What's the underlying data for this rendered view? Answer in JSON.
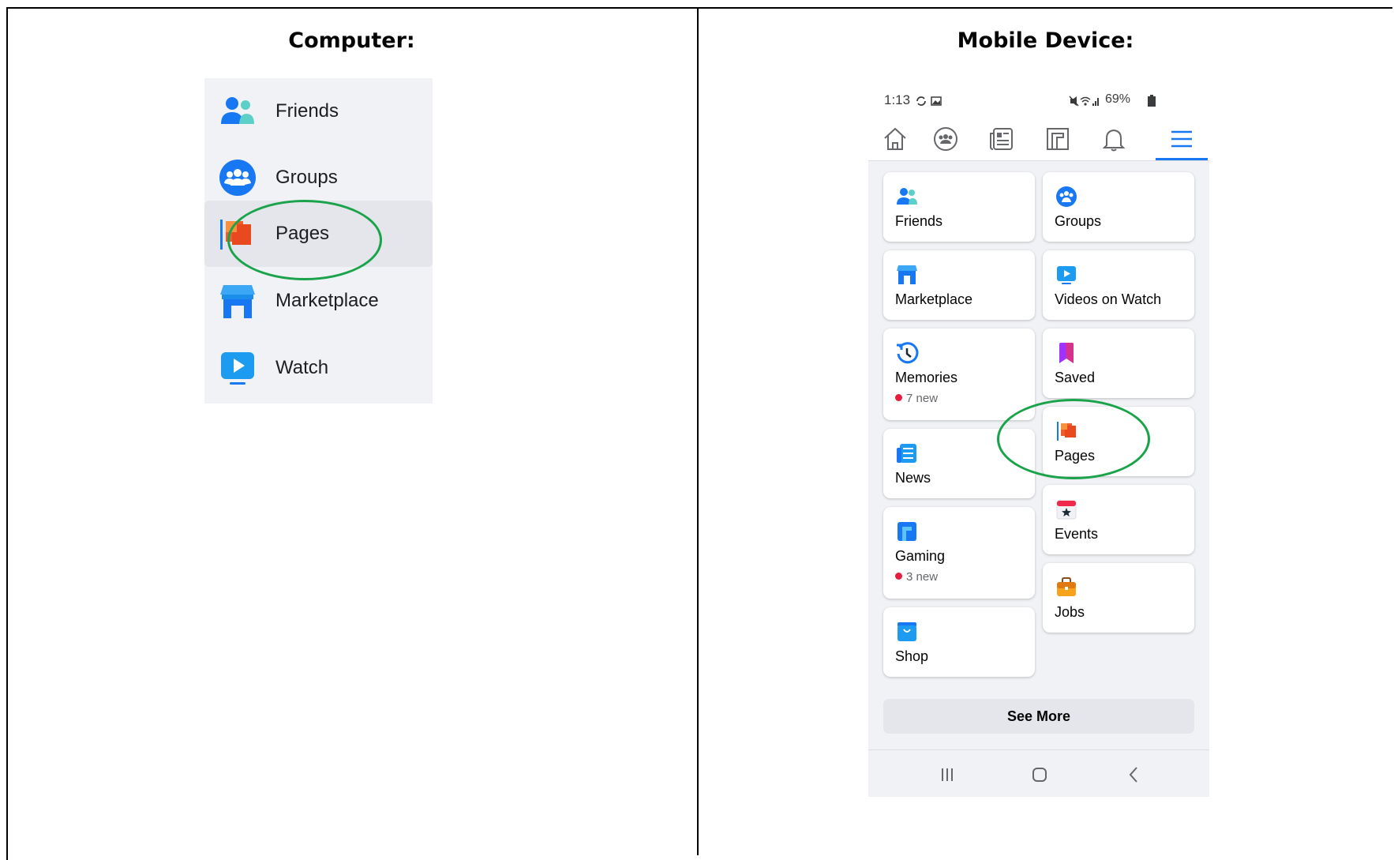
{
  "headings": {
    "computer": "Computer:",
    "mobile": "Mobile Device:"
  },
  "computer_sidebar": {
    "items": [
      {
        "label": "Friends",
        "icon": "friends-icon"
      },
      {
        "label": "Groups",
        "icon": "groups-icon"
      },
      {
        "label": "Pages",
        "icon": "pages-icon",
        "active": true
      },
      {
        "label": "Marketplace",
        "icon": "marketplace-icon"
      },
      {
        "label": "Watch",
        "icon": "watch-icon"
      }
    ]
  },
  "mobile": {
    "status_bar": {
      "time": "1:13",
      "battery": "69%"
    },
    "nav_icons": [
      "home-icon",
      "groups-icon",
      "news-icon",
      "gaming-icon",
      "bell-icon",
      "menu-icon"
    ],
    "left_tiles": [
      {
        "label": "Friends",
        "icon": "friends-icon"
      },
      {
        "label": "Marketplace",
        "icon": "marketplace-icon"
      },
      {
        "label": "Memories",
        "icon": "memories-icon",
        "badge": "7 new"
      },
      {
        "label": "News",
        "icon": "news-icon"
      },
      {
        "label": "Gaming",
        "icon": "gaming-icon",
        "badge": "3 new"
      },
      {
        "label": "Shop",
        "icon": "shop-icon"
      }
    ],
    "right_tiles": [
      {
        "label": "Groups",
        "icon": "groups-icon"
      },
      {
        "label": "Videos on Watch",
        "icon": "watch-icon"
      },
      {
        "label": "Saved",
        "icon": "saved-icon"
      },
      {
        "label": "Pages",
        "icon": "pages-icon"
      },
      {
        "label": "Events",
        "icon": "events-icon"
      },
      {
        "label": "Jobs",
        "icon": "jobs-icon"
      }
    ],
    "see_more": "See More"
  },
  "colors": {
    "highlight_circle": "#1aa34a",
    "facebook_blue": "#1877f2",
    "badge_dot": "#e41e3f"
  }
}
